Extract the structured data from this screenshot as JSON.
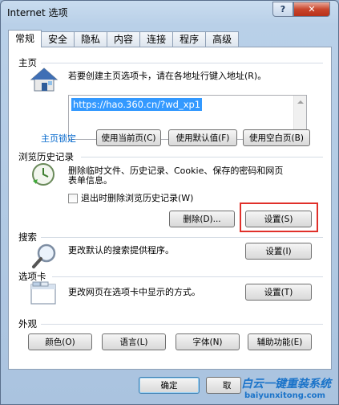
{
  "window": {
    "title": "Internet 选项",
    "help_label": "?",
    "close_label": "✕"
  },
  "tabs": [
    {
      "label": "常规",
      "active": true
    },
    {
      "label": "安全"
    },
    {
      "label": "隐私"
    },
    {
      "label": "内容"
    },
    {
      "label": "连接"
    },
    {
      "label": "程序"
    },
    {
      "label": "高级"
    }
  ],
  "home": {
    "title": "主页",
    "desc": "若要创建主页选项卡，请在各地址行键入地址(R)。",
    "url": "https://hao.360.cn/?wd_xp1",
    "lock_link": "主页锁定",
    "use_current": "使用当前页(C)",
    "use_default": "使用默认值(F)",
    "use_blank": "使用空白页(B)"
  },
  "history": {
    "title": "浏览历史记录",
    "desc_line1": "删除临时文件、历史记录、Cookie、保存的密码和网页",
    "desc_line2": "表单信息。",
    "checkbox_label": "退出时删除浏览历史记录(W)",
    "delete_button": "删除(D)...",
    "settings_button": "设置(S)"
  },
  "search": {
    "title": "搜索",
    "desc": "更改默认的搜索提供程序。",
    "settings_button": "设置(I)"
  },
  "tabs_section": {
    "title": "选项卡",
    "desc": "更改网页在选项卡中显示的方式。",
    "settings_button": "设置(T)"
  },
  "appearance": {
    "title": "外观",
    "colors": "颜色(O)",
    "languages": "语言(L)",
    "fonts": "字体(N)",
    "accessibility": "辅助功能(E)"
  },
  "footer": {
    "ok": "确定",
    "cancel_partial": "取"
  },
  "watermark": {
    "line1": "白云一键重装系统",
    "line2": "baiyunxitong.com"
  }
}
